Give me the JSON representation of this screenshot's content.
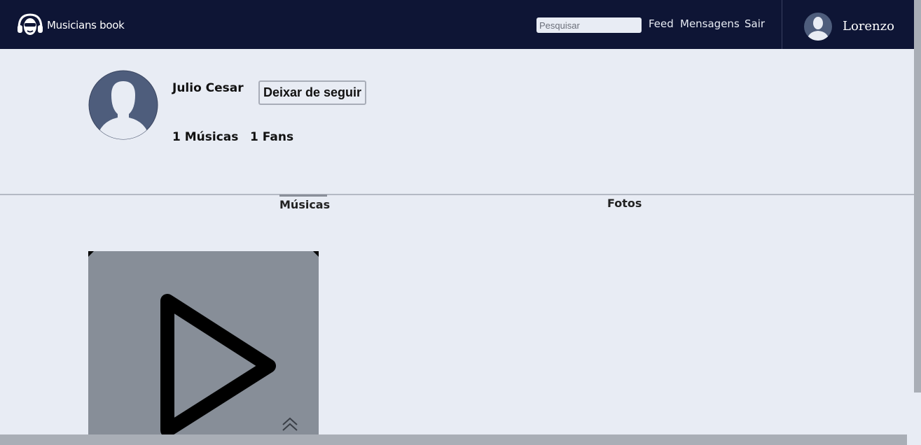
{
  "header": {
    "app_name": "Musicians book",
    "search_placeholder": "Pesquisar",
    "nav": {
      "feed": "Feed",
      "messages": "Mensagens",
      "logout": "Sair"
    },
    "current_user": "Lorenzo"
  },
  "profile": {
    "name": "Julio Cesar",
    "unfollow_label": "Deixar de seguir",
    "songs_count": "1 Músicas",
    "fans_count": "1 Fans"
  },
  "tabs": {
    "music": "Músicas",
    "photos": "Fotos"
  },
  "icons": {
    "logo": "headphones-face-logo-icon",
    "avatar": "user-silhouette-icon",
    "play": "play-icon",
    "up": "double-chevron-up-icon"
  },
  "colors": {
    "header_bg": "#0e1535",
    "page_bg": "#e8ecf4",
    "avatar_bg": "#4e5d7c",
    "card_bg": "#878e98"
  }
}
